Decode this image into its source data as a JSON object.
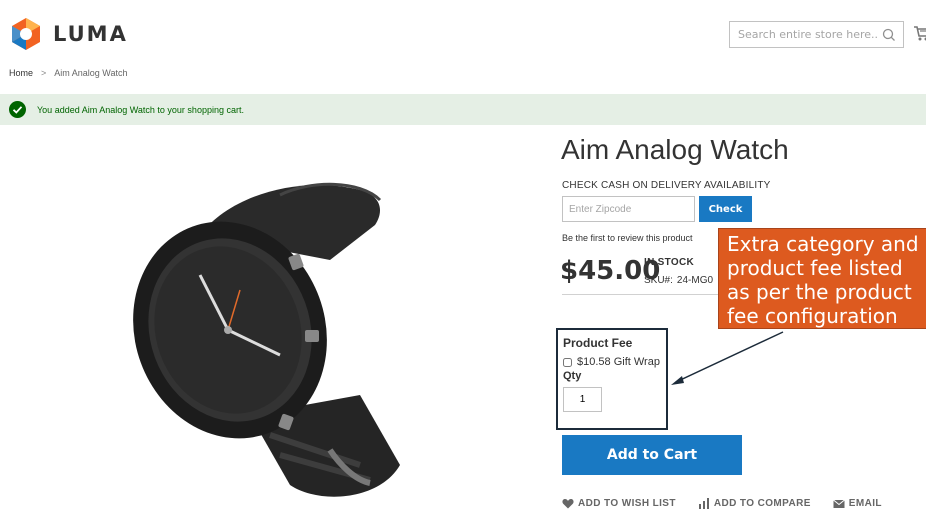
{
  "header": {
    "logo_text": "LUMA",
    "search_placeholder": "Search entire store here..."
  },
  "breadcrumb": {
    "home": "Home",
    "separator": ">",
    "current": "Aim Analog Watch"
  },
  "message": {
    "text": "You added Aim Analog Watch to your shopping cart."
  },
  "product": {
    "title": "Aim Analog Watch",
    "cod_label": "CHECK CASH ON DELIVERY AVAILABILITY",
    "zip_placeholder": "Enter Zipcode",
    "check_label": "Check",
    "review_text": "Be the first to review this product",
    "price": "$45.00",
    "stock": "IN STOCK",
    "sku_label": "SKU#:",
    "sku_value": "24-MG0"
  },
  "fee": {
    "title": "Product Fee",
    "option_label": "$10.58 Gift Wrap",
    "qty_label": "Qty",
    "qty_value": "1"
  },
  "cart": {
    "add_label": "Add to Cart"
  },
  "actions": {
    "wishlist": "ADD TO WISH LIST",
    "compare": "ADD TO COMPARE",
    "email": "EMAIL"
  },
  "callout": {
    "line1": "Extra category and",
    "line2": "product fee listed",
    "line3": "as per the product",
    "line4": "fee configuration"
  },
  "colors": {
    "primary": "#1979c3",
    "success_bg": "#e5efe5",
    "success_text": "#006400",
    "callout": "#dd5a1f"
  }
}
